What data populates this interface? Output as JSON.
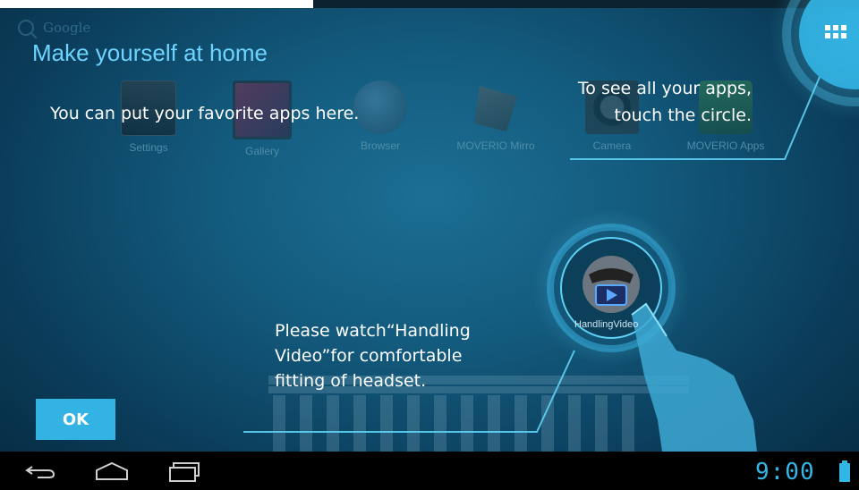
{
  "search": {
    "label": "Google"
  },
  "apps": [
    {
      "label": "Settings",
      "icon": "settings-icon"
    },
    {
      "label": "Gallery",
      "icon": "gallery-icon"
    },
    {
      "label": "Browser",
      "icon": "browser-icon"
    },
    {
      "label": "MOVERIO Mirro",
      "icon": "moverio-mirror-icon"
    },
    {
      "label": "Camera",
      "icon": "camera-icon"
    },
    {
      "label": "MOVERIO Apps",
      "icon": "moverio-apps-icon"
    }
  ],
  "overlay": {
    "title": "Make yourself at home",
    "favorites_hint": "You can put your favorite apps here.",
    "all_apps_hint_line1": "To see all your apps,",
    "all_apps_hint_line2": "touch the circle.",
    "video_hint_line1": "Please watch“Handling",
    "video_hint_line2": "Video”for comfortable",
    "video_hint_line3": "fitting of headset.",
    "ok_label": "OK",
    "video_app_label": "HandlingVideo"
  },
  "statusbar": {
    "time": "9:00"
  },
  "colors": {
    "accent": "#33b5e5",
    "title": "#6fd3ff",
    "ok_button": "#33b3e3"
  }
}
